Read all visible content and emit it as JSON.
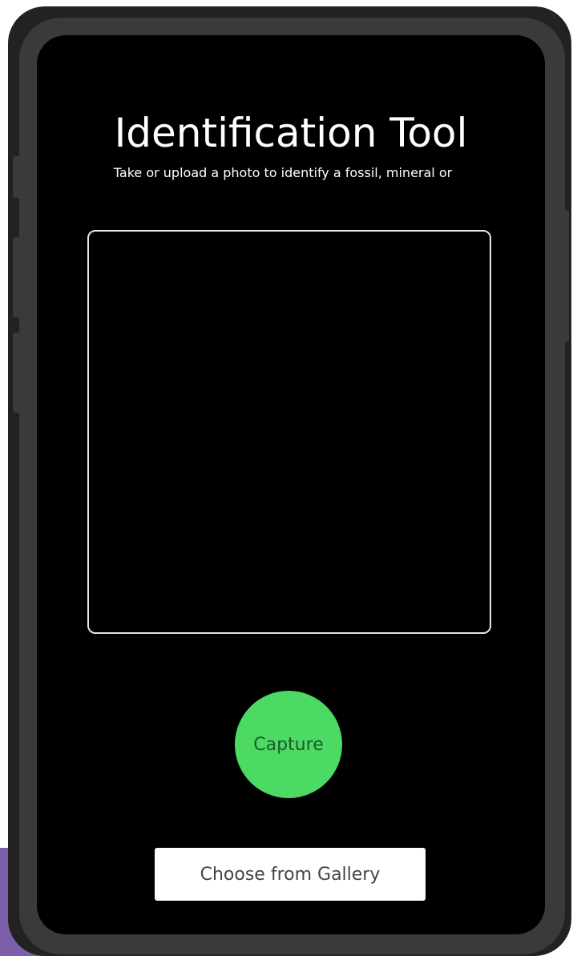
{
  "app": {
    "title": "Identification Tool",
    "subtitle": "Take or upload a photo to identify a fossil, mineral or"
  },
  "actions": {
    "capture_label": "Capture",
    "gallery_label": "Choose from Gallery"
  },
  "colors": {
    "screen_background": "#000000",
    "capture_accent": "#4cd964",
    "phone_frame": "#3a3a3a",
    "backdrop_purple": "#7b5fa8"
  }
}
